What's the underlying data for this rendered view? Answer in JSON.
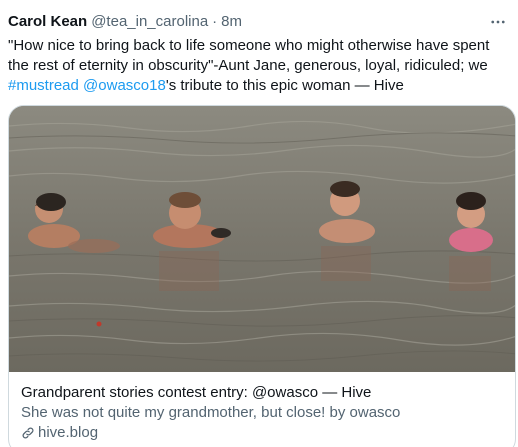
{
  "tweet": {
    "author": {
      "display_name": "Carol Kean",
      "handle": "@tea_in_carolina",
      "separator": "·",
      "timestamp": "8m"
    },
    "more_icon": "more-dots-icon",
    "text": {
      "part1": "\"How nice to bring back to life someone who might otherwise have spent the rest of eternity in obscurity\"-Aunt Jane, generous, loyal, ridiculed; we ",
      "hashtag": "#mustread",
      "space": " ",
      "mention": "@owasco18",
      "part2": "'s tribute to this epic woman — Hive"
    },
    "card": {
      "title": "Grandparent stories contest entry: @owasco — Hive",
      "description": "She was not quite my grandmother, but close! by owasco",
      "domain": "hive.blog",
      "domain_icon": "link-icon"
    }
  },
  "colors": {
    "text": "#0f1419",
    "secondary": "#536471",
    "link": "#1d9bf0",
    "border": "#cfd9de"
  }
}
